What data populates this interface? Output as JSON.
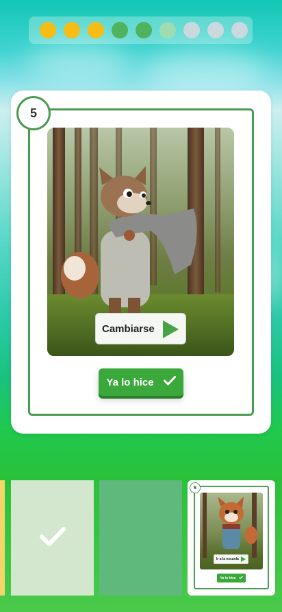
{
  "progress": {
    "dots": [
      "done",
      "done",
      "done",
      "active",
      "active",
      "next",
      "todo",
      "todo",
      "todo"
    ]
  },
  "current_card": {
    "step_number": "5",
    "action_label": "Cambiarse",
    "done_button_label": "Ya lo hice"
  },
  "next_card": {
    "step_number": "6",
    "action_label": "Ir a la escuela",
    "done_button_label": "Ya lo hice"
  },
  "colors": {
    "accent_green": "#3aa83a",
    "frame_green": "#4a9b52",
    "completed_dot": "#f6bd17"
  },
  "icons": [
    "play-icon",
    "check-icon"
  ]
}
